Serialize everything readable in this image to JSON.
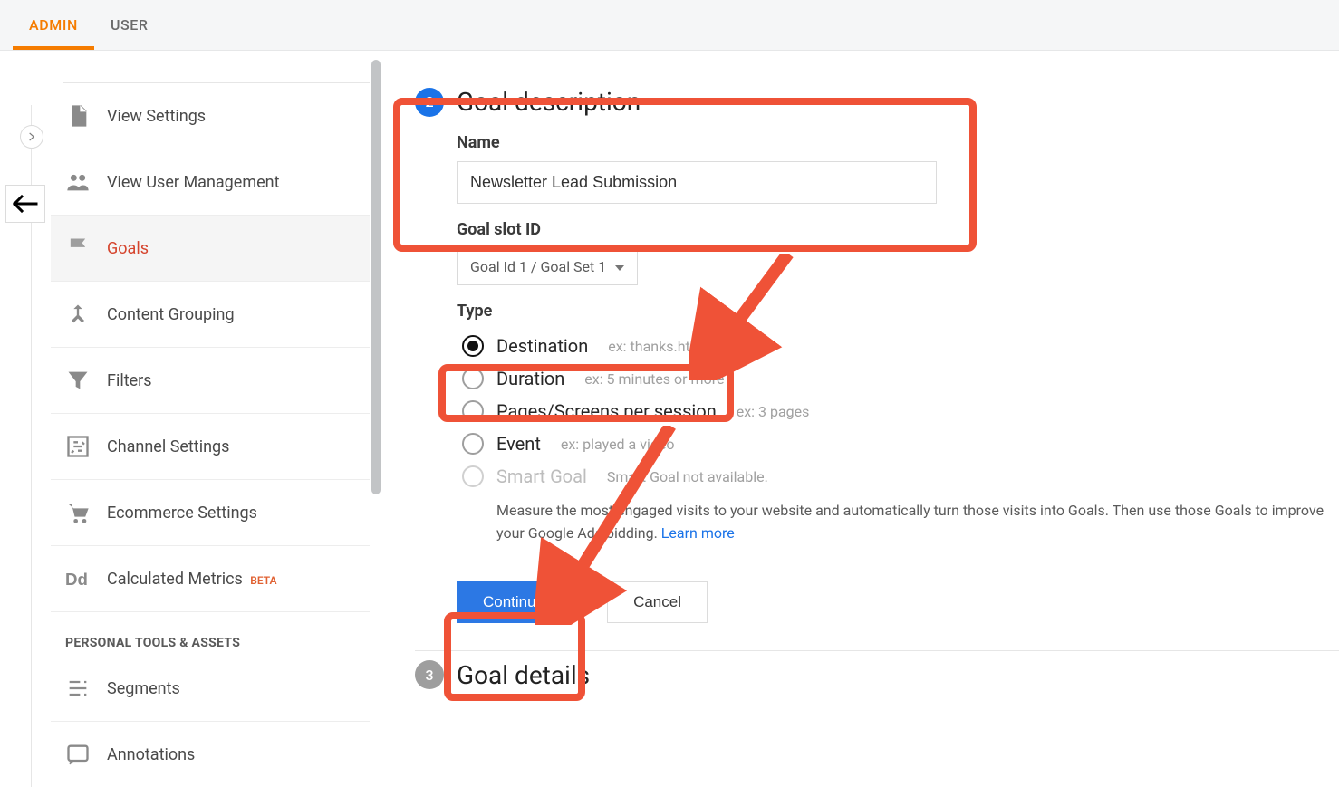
{
  "tabs": {
    "admin": "ADMIN",
    "user": "USER"
  },
  "sidebar": {
    "items": [
      {
        "label": "View Settings"
      },
      {
        "label": "View User Management"
      },
      {
        "label": "Goals"
      },
      {
        "label": "Content Grouping"
      },
      {
        "label": "Filters"
      },
      {
        "label": "Channel Settings"
      },
      {
        "label": "Ecommerce Settings"
      },
      {
        "label": "Calculated Metrics",
        "badge": "BETA"
      }
    ],
    "section": "PERSONAL TOOLS & ASSETS",
    "section_items": [
      {
        "label": "Segments"
      },
      {
        "label": "Annotations"
      }
    ]
  },
  "goal": {
    "step2_number": "2",
    "step3_number": "3",
    "desc_title": "Goal description",
    "name_label": "Name",
    "name_value": "Newsletter Lead Submission",
    "slot_label": "Goal slot ID",
    "slot_value": "Goal Id 1 / Goal Set 1",
    "type_label": "Type",
    "types": {
      "destination": {
        "label": "Destination",
        "hint": "ex: thanks.html"
      },
      "duration": {
        "label": "Duration",
        "hint": "ex: 5 minutes or more"
      },
      "pages": {
        "label": "Pages/Screens per session",
        "hint": "ex: 3 pages"
      },
      "event": {
        "label": "Event",
        "hint": "ex: played a video"
      },
      "smart": {
        "label": "Smart Goal",
        "hint": "Smart Goal not available."
      }
    },
    "smart_blurb": "Measure the most engaged visits to your website and automatically turn those visits into Goals. Then use those Goals to improve your Google Ads bidding.",
    "learn_more": "Learn more",
    "continue": "Continue",
    "cancel": "Cancel",
    "details_title": "Goal details"
  }
}
